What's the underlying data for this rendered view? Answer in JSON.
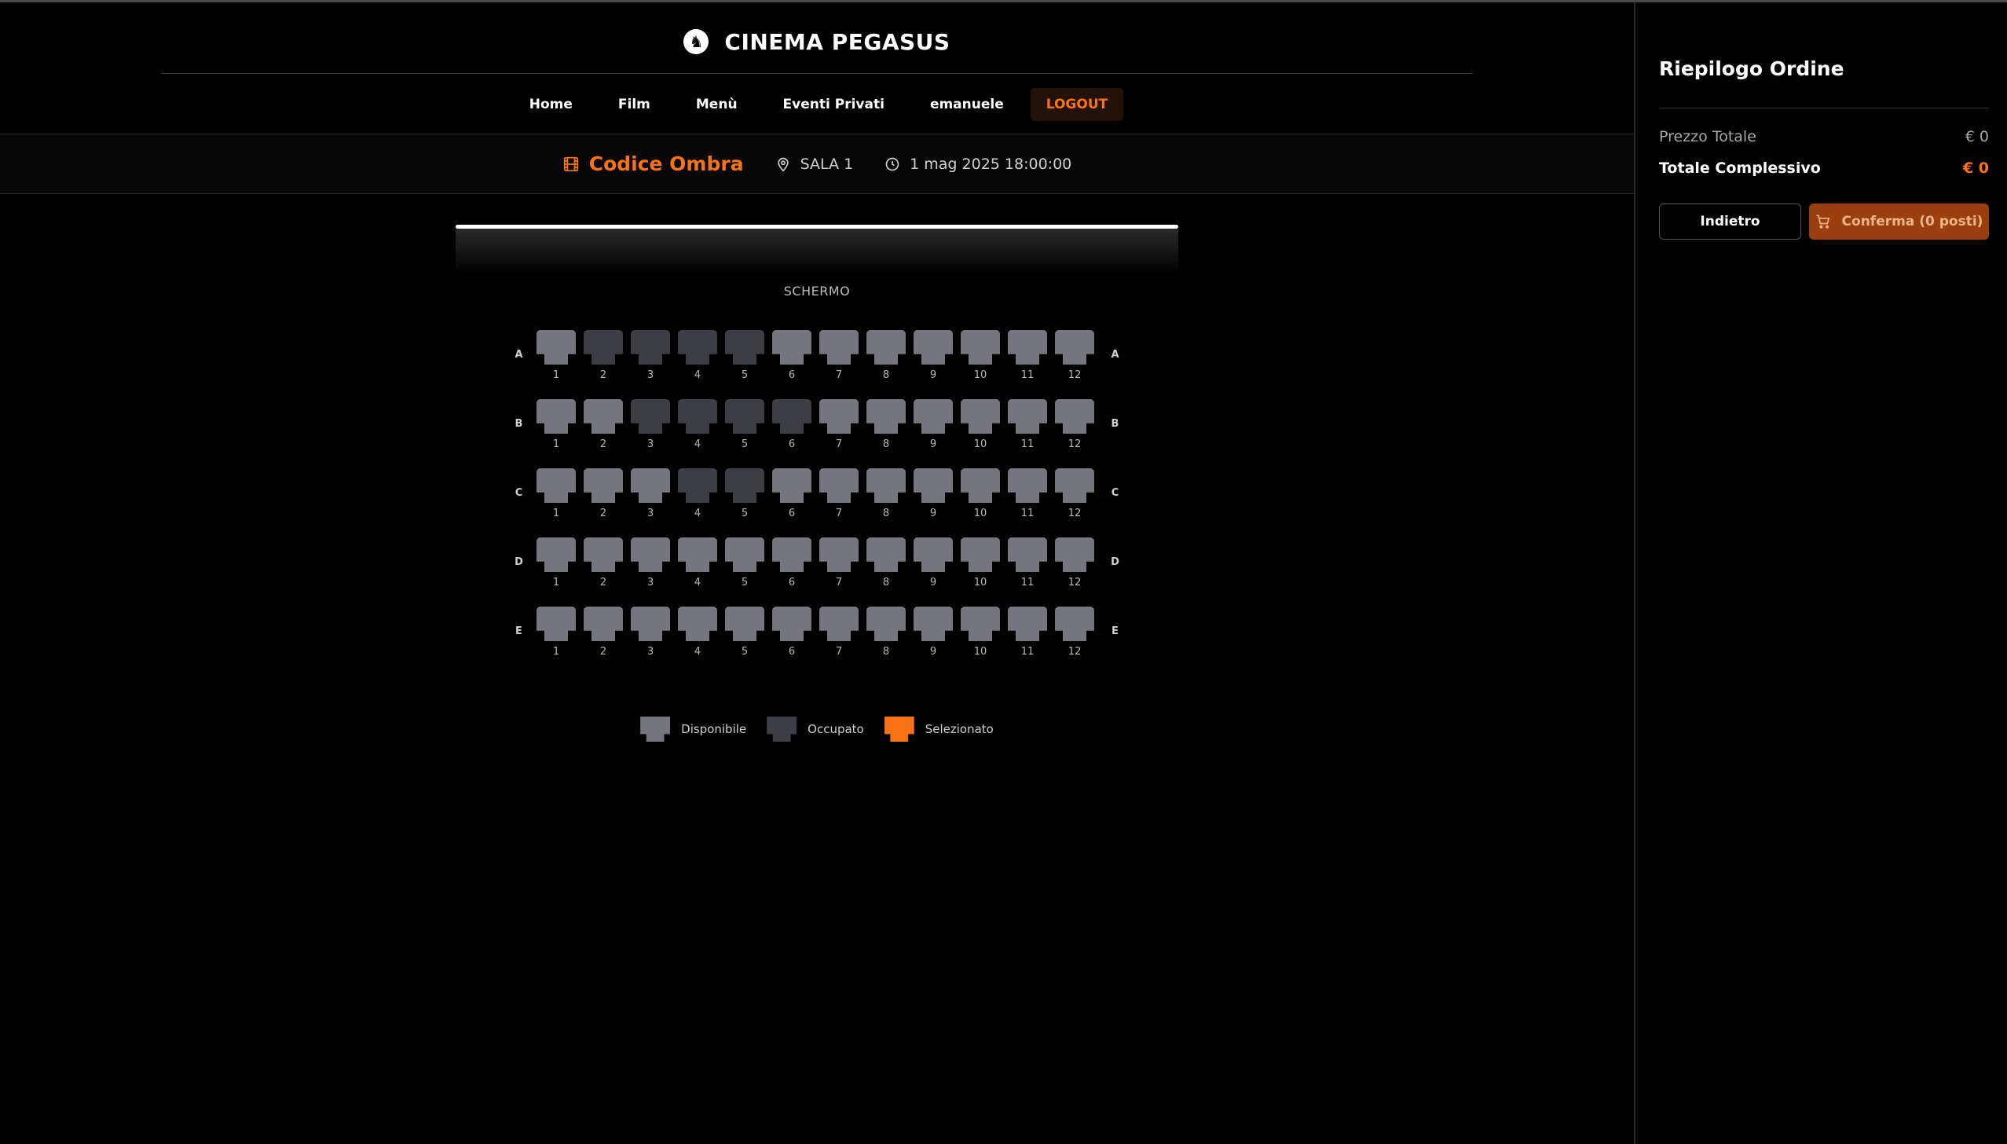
{
  "brand": {
    "title": "CINEMA PEGASUS",
    "logo_icon": "pegasus-logo-icon"
  },
  "nav": {
    "items": [
      {
        "label": "Home"
      },
      {
        "label": "Film"
      },
      {
        "label": "Menù"
      },
      {
        "label": "Eventi Privati"
      },
      {
        "label": "emanuele"
      }
    ],
    "logout": "LOGOUT"
  },
  "showing": {
    "film": "Codice Ombra",
    "film_icon": "film-icon",
    "room": "SALA 1",
    "room_icon": "map-pin-icon",
    "datetime": "1 mag 2025 18:00:00",
    "datetime_icon": "clock-icon"
  },
  "screen": {
    "label": "SCHERMO"
  },
  "seats": {
    "rows": [
      {
        "label": "A",
        "occupied": [
          2,
          3,
          4,
          5
        ]
      },
      {
        "label": "B",
        "occupied": [
          3,
          4,
          5,
          6
        ]
      },
      {
        "label": "C",
        "occupied": [
          4,
          5
        ]
      },
      {
        "label": "D",
        "occupied": []
      },
      {
        "label": "E",
        "occupied": []
      }
    ],
    "numbers": [
      "1",
      "2",
      "3",
      "4",
      "5",
      "6",
      "7",
      "8",
      "9",
      "10",
      "11",
      "12"
    ]
  },
  "legend": {
    "available": "Disponibile",
    "occupied": "Occupato",
    "selected": "Selezionato"
  },
  "order": {
    "title": "Riepilogo Ordine",
    "subtotal_label": "Prezzo Totale",
    "subtotal_value": "€ 0",
    "total_label": "Totale Complessivo",
    "total_value": "€ 0",
    "back_button": "Indietro",
    "confirm_button": "Conferma (0 posti)",
    "confirm_icon": "cart-icon"
  },
  "colors": {
    "accent": "#f97316",
    "seat_available": "#75757d",
    "seat_occupied": "#3d3d44",
    "seat_selected": "#f97316",
    "background": "#000000"
  }
}
